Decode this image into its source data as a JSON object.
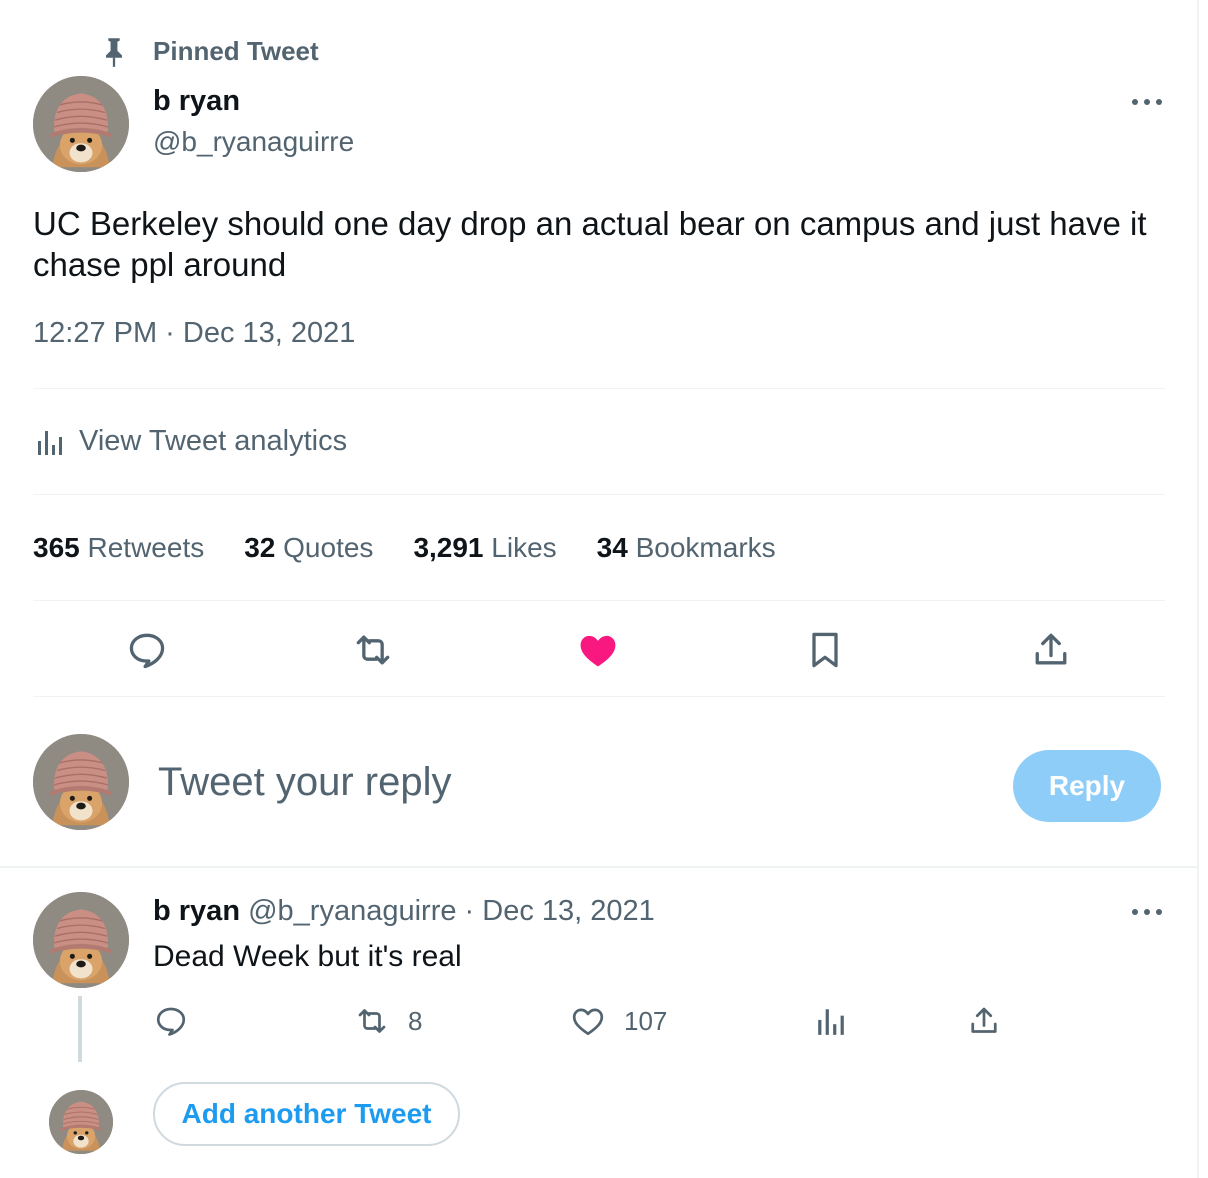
{
  "colors": {
    "accent": "#1d9bf0",
    "reply_button_disabled": "#8ecdf8",
    "like_active": "#f91880",
    "muted_text": "#536471",
    "divider": "#eff3f4"
  },
  "pinned_label": "Pinned Tweet",
  "tweet": {
    "author_name": "b ryan",
    "author_handle": "@b_ryanaguirre",
    "text": "UC Berkeley should one day drop an actual bear on campus and just have it chase ppl around",
    "timestamp": "12:27 PM · Dec 13, 2021",
    "analytics_label": "View Tweet analytics",
    "stats": {
      "retweets_count": "365",
      "retweets_label": "Retweets",
      "quotes_count": "32",
      "quotes_label": "Quotes",
      "likes_count": "3,291",
      "likes_label": "Likes",
      "bookmarks_count": "34",
      "bookmarks_label": "Bookmarks"
    },
    "actions": [
      "reply-icon",
      "retweet-icon",
      "like-icon-filled",
      "bookmark-icon",
      "share-icon"
    ]
  },
  "composer": {
    "placeholder": "Tweet your reply",
    "reply_button": "Reply"
  },
  "reply": {
    "author_name": "b ryan",
    "author_handle": "@b_ryanaguirre",
    "separator": "·",
    "date": "Dec 13, 2021",
    "text": "Dead Week but it's real",
    "retweets": "8",
    "likes": "107"
  },
  "add_another_label": "Add another Tweet"
}
